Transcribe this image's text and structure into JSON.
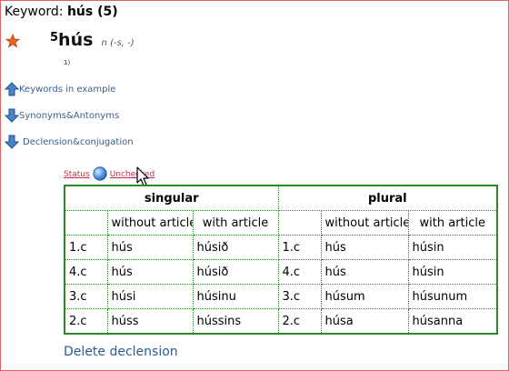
{
  "header": {
    "label": "Keyword:",
    "keyword": "hús (5)"
  },
  "entry": {
    "index": "5",
    "headword": "hús",
    "grammar": "n (-s, -)",
    "note": "1)"
  },
  "nav": {
    "keywords_example": "Keywords in example",
    "synonyms": "Synonyms&Antonyms",
    "declension": "Declension&conjugation"
  },
  "status": {
    "label": "Status",
    "value": "Unchecked"
  },
  "declension": {
    "groups": [
      "singular",
      "plural"
    ],
    "subheaders": [
      "without article",
      "with article",
      "without article",
      "with article"
    ],
    "rows": [
      [
        "1.c",
        "hús",
        "húsið",
        "1.c",
        "hús",
        "húsin"
      ],
      [
        "4.c",
        "hús",
        "húsið",
        "4.c",
        "hús",
        "húsin"
      ],
      [
        "3.c",
        "húsi",
        "húsinu",
        "3.c",
        "húsum",
        "húsunum"
      ],
      [
        "2.c",
        "húss",
        "hússins",
        "2.c",
        "húsa",
        "húsanna"
      ]
    ]
  },
  "actions": {
    "delete_label": "Delete declension"
  },
  "colors": {
    "table_border": "#2a8a2a",
    "link": "#3a5f8a",
    "status": "#c0304a",
    "frame": "#e06060"
  },
  "icons": [
    "star-icon",
    "arrow-up-icon",
    "arrow-down-icon",
    "globe-icon",
    "mouse-cursor-icon"
  ]
}
